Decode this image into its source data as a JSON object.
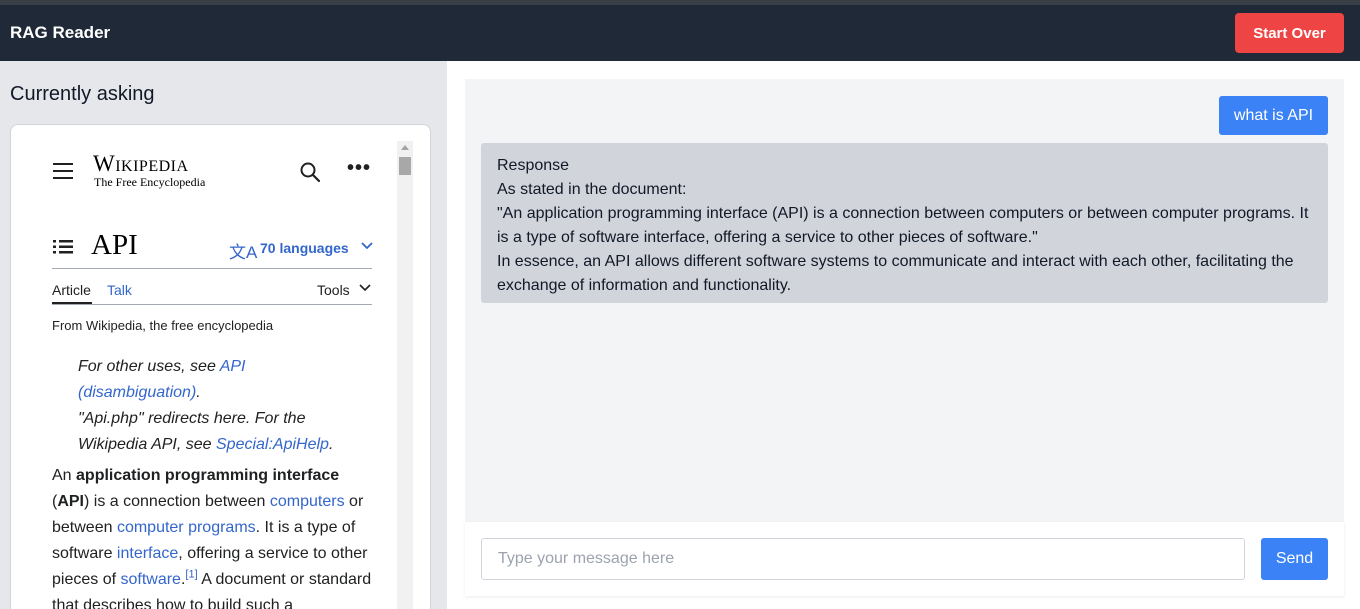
{
  "app": {
    "title": "RAG Reader",
    "start_over_label": "Start Over"
  },
  "left": {
    "heading": "Currently asking",
    "wiki": {
      "logo_title": "Wikipedia",
      "logo_tagline": "The Free Encyclopedia",
      "page_title": "API",
      "languages": "70 languages",
      "tabs": {
        "article": "Article",
        "talk": "Talk",
        "tools": "Tools"
      },
      "from_line": "From Wikipedia, the free encyclopedia",
      "hatnote": {
        "t1": "For other uses, see ",
        "l1": "API (disambiguation)",
        "t2": ".",
        "t3": "\"Api.php\" redirects here. For the Wikipedia API, see ",
        "l2": "Special:ApiHelp",
        "t4": "."
      },
      "lead": {
        "t1": "An ",
        "b1": "application programming interface",
        "t2": " (",
        "b2": "API",
        "t3": ") is a connection between ",
        "l1": "computers",
        "t4": " or between ",
        "l2": "computer programs",
        "t5": ". It is a type of software ",
        "l3": "interface",
        "t6": ", offering a service to other pieces of ",
        "l4": "software",
        "t7": ".",
        "sup": "[1]",
        "t8": " A document or standard that describes how to build such a"
      }
    }
  },
  "chat": {
    "user_message": "what is API",
    "response_lines": [
      "Response",
      "As stated in the document:",
      "\"An application programming interface (API) is a connection between computers or between computer programs. It is a type of software interface, offering a service to other pieces of software.\"",
      "In essence, an API allows different software systems to communicate and interact with each other, facilitating the exchange of information and functionality."
    ],
    "input_placeholder": "Type your message here",
    "input_value": "",
    "send_label": "Send"
  },
  "colors": {
    "navbar": "#1f2937",
    "start_over": "#ef4444",
    "accent_blue": "#3b82f6",
    "wiki_link": "#3366cc"
  }
}
